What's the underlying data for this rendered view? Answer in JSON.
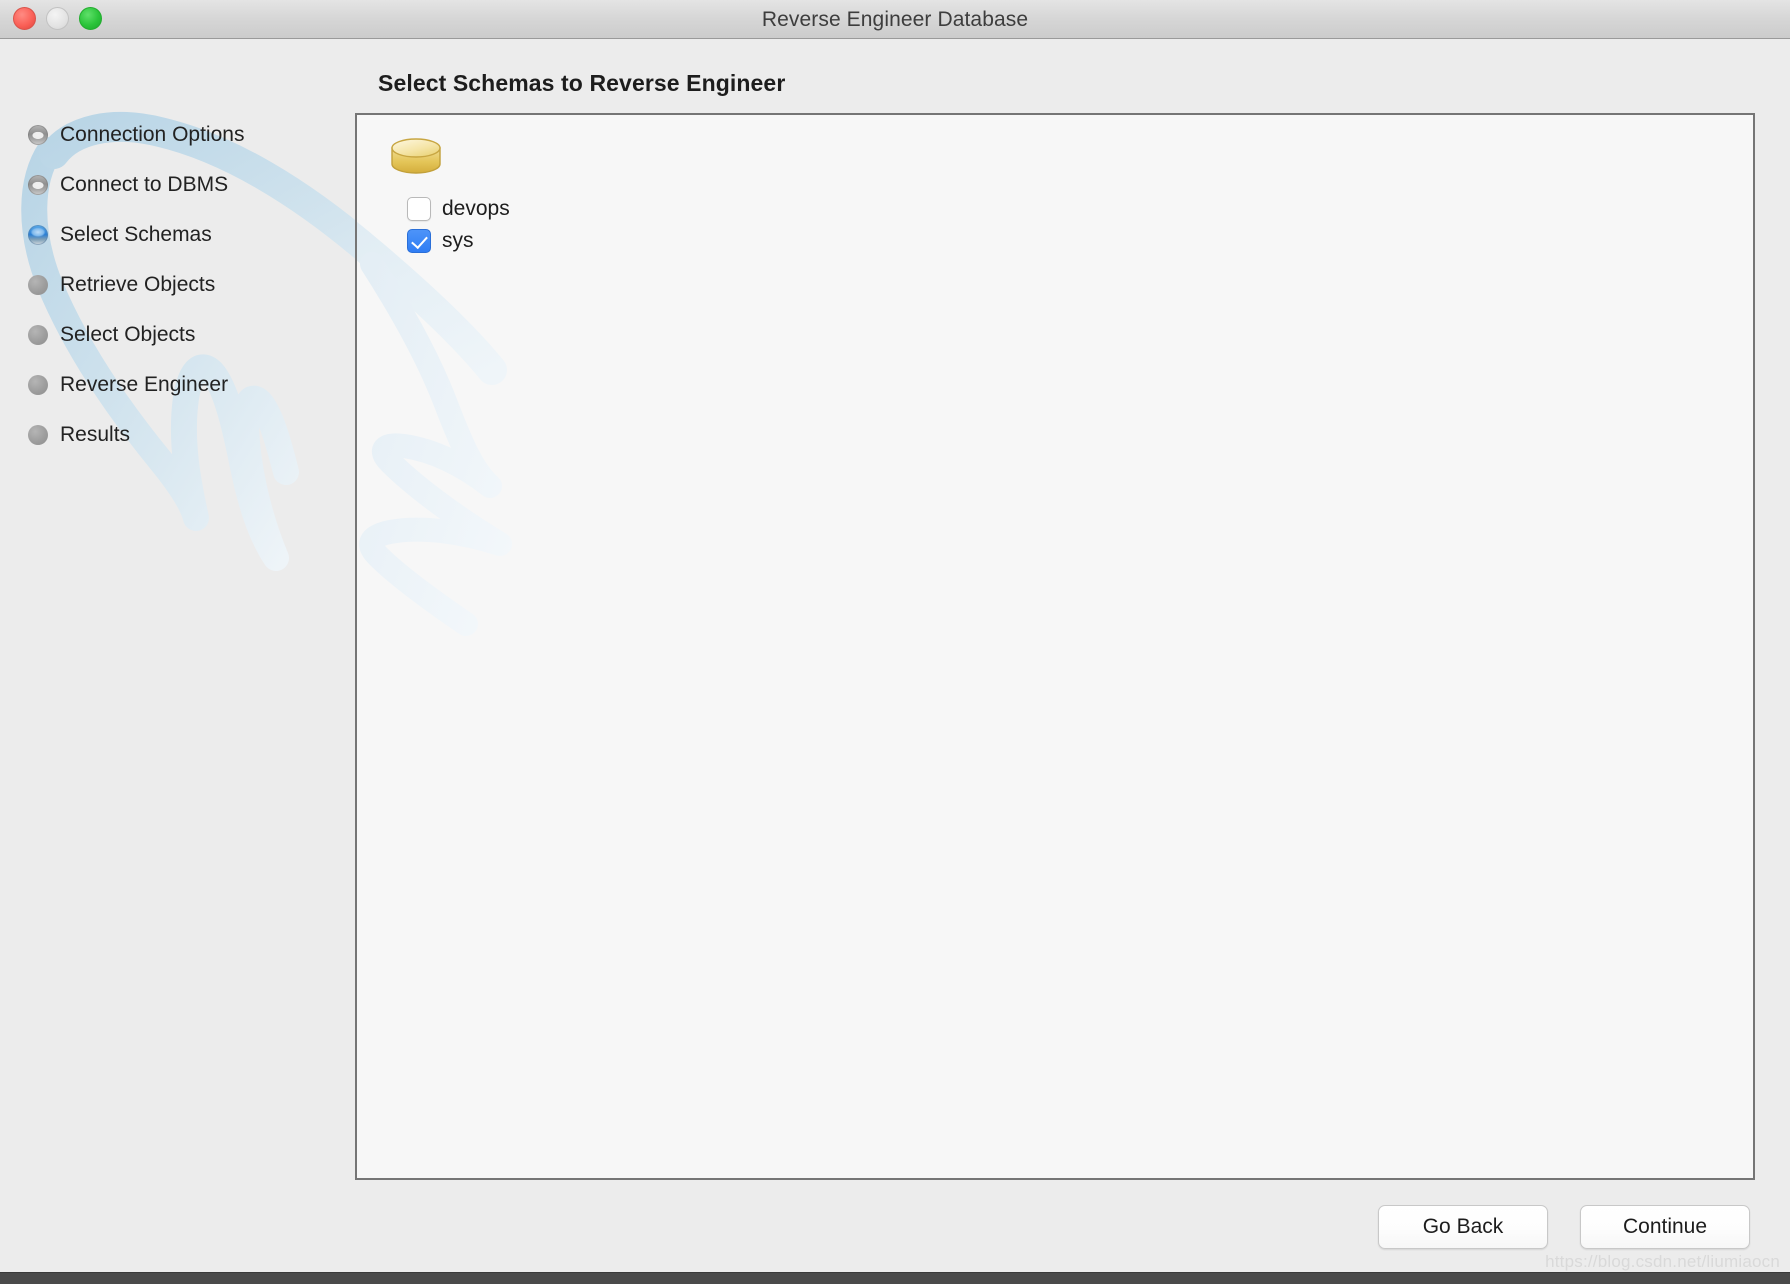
{
  "window": {
    "title": "Reverse Engineer Database",
    "traffic_lights": [
      {
        "name": "close",
        "color": "#fa6158",
        "enabled": true
      },
      {
        "name": "minimize",
        "color": "#e3e3e3",
        "enabled": false
      },
      {
        "name": "zoom",
        "color": "#2bc43a",
        "enabled": true
      }
    ]
  },
  "page": {
    "heading": "Select Schemas to Reverse Engineer"
  },
  "sidebar": {
    "items": [
      {
        "label": "Connection Options",
        "state": "done"
      },
      {
        "label": "Connect to DBMS",
        "state": "done"
      },
      {
        "label": "Select Schemas",
        "state": "active"
      },
      {
        "label": "Retrieve Objects",
        "state": "pending"
      },
      {
        "label": "Select Objects",
        "state": "pending"
      },
      {
        "label": "Reverse Engineer",
        "state": "pending"
      },
      {
        "label": "Results",
        "state": "pending"
      }
    ]
  },
  "panel": {
    "db_icon": "database-cylinder-icon",
    "schemas": [
      {
        "name": "devops",
        "checked": false
      },
      {
        "name": "sys",
        "checked": true
      }
    ]
  },
  "footer": {
    "go_back_label": "Go Back",
    "continue_label": "Continue"
  },
  "watermark": {
    "text": "https://blog.csdn.net/liumiaocn"
  },
  "colors": {
    "accent_blue": "#2f7df4",
    "window_bg": "#ececec",
    "panel_bg": "#f7f7f7",
    "panel_border": "#757575",
    "db_icon_gold": "#e3c14e",
    "dolphin_blue": "#c5dbe8"
  }
}
